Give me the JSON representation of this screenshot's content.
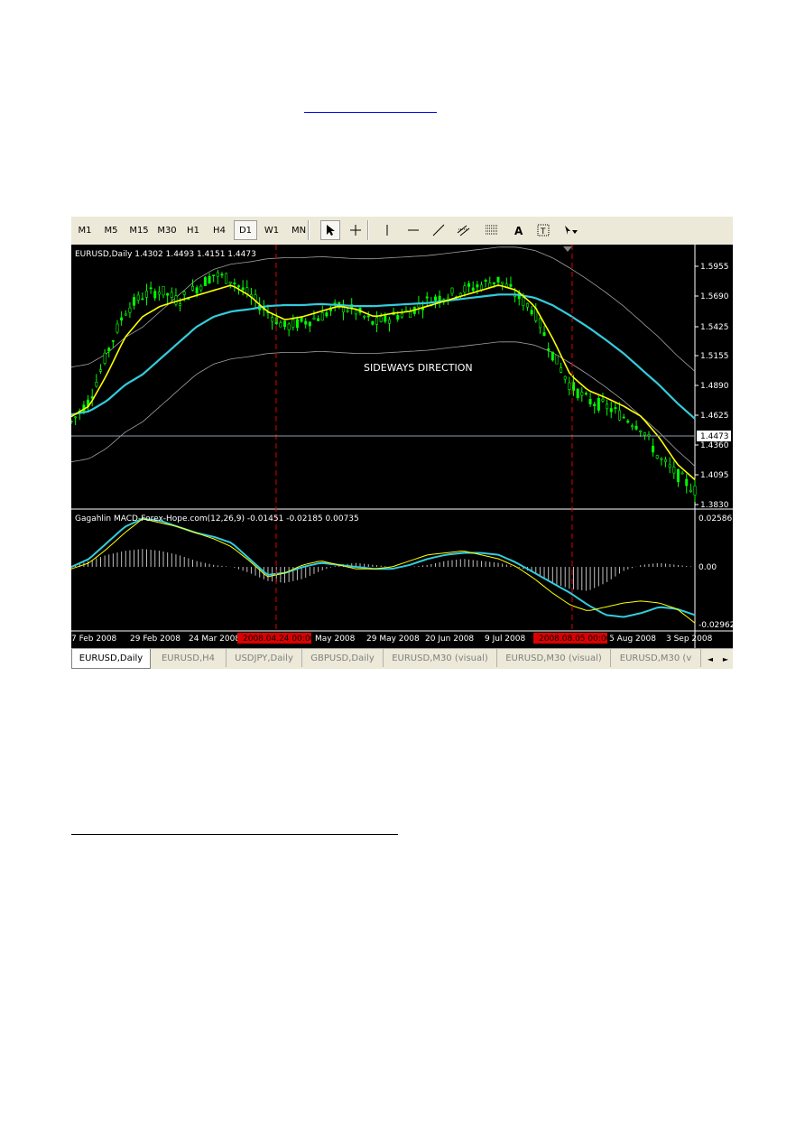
{
  "toolbar": {
    "timeframes": [
      "M1",
      "M5",
      "M15",
      "M30",
      "H1",
      "H4",
      "D1",
      "W1",
      "MN"
    ],
    "active_timeframe": "D1",
    "tools": [
      {
        "name": "cursor-icon",
        "active": true
      },
      {
        "name": "crosshair-icon",
        "active": false
      },
      {
        "name": "vertical-line-icon",
        "active": false
      },
      {
        "name": "horizontal-line-icon",
        "active": false
      },
      {
        "name": "trend-line-icon",
        "active": false
      },
      {
        "name": "equidistant-channel-icon",
        "active": false
      },
      {
        "name": "fibonacci-retracement-icon",
        "active": false
      },
      {
        "name": "text-icon",
        "active": false
      },
      {
        "name": "text-label-icon",
        "active": false
      },
      {
        "name": "arrows-dropdown-icon",
        "active": false
      }
    ]
  },
  "main_chart": {
    "header": "EURUSD,Daily  1.4302 1.4493 1.4151 1.4473",
    "annotation": "SIDEWAYS DIRECTION",
    "price_labels": [
      "1.5955",
      "1.5690",
      "1.5425",
      "1.5155",
      "1.4890",
      "1.4625",
      "1.4360",
      "1.4095",
      "1.3830"
    ],
    "current_price": "1.4473",
    "current_value": 1.4473,
    "y_range": [
      1.373,
      1.608
    ]
  },
  "indicator": {
    "header": "Gagahlin MACD-Forex-Hope.com(12,26,9) -0.01451 -0.02185 0.00735",
    "labels": [
      "0.02586",
      "0.00",
      "-0.02962"
    ],
    "y_range": [
      -0.0315,
      0.0275
    ]
  },
  "time_axis": {
    "labels": [
      "7 Feb 2008",
      "29 Feb 2008",
      "24 Mar 2008",
      "May 2008",
      "29 May 2008",
      "20 Jun 2008",
      "9 Jul 2008",
      "5 Aug 2008",
      "3 Sep 2008"
    ],
    "markers": [
      "2008.04.24 00:00",
      "2008.08.05 00:00"
    ]
  },
  "tabs": [
    "EURUSD,Daily",
    "EURUSD,H4",
    "USDJPY,Daily",
    "GBPUSD,Daily",
    "EURUSD,M30 (visual)",
    "EURUSD,M30 (visual)",
    "EURUSD,M30 (v"
  ],
  "active_tab": "EURUSD,Daily",
  "colors": {
    "background": "#000000",
    "candles": "#00ff00",
    "fast_ma": "#ffff00",
    "slow_ma": "#33ccdd",
    "bands": "#a0a0a0",
    "markers": "#dd0000",
    "histogram": "#c0c0c0"
  },
  "chart_data": {
    "type": "line",
    "series": [],
    "x": [
      "2008-02-07",
      "2008-02-29",
      "2008-03-24",
      "2008-04-24",
      "2008-05-29",
      "2008-06-20",
      "2008-07-09",
      "2008-08-05",
      "2008-09-03"
    ],
    "close_path": [
      1.455,
      1.475,
      1.52,
      1.56,
      1.575,
      1.58,
      1.57,
      1.582,
      1.595,
      1.59,
      1.575,
      1.56,
      1.545,
      1.55,
      1.555,
      1.565,
      1.56,
      1.548,
      1.555,
      1.56,
      1.57,
      1.575,
      1.58,
      1.585,
      1.59,
      1.575,
      1.56,
      1.52,
      1.49,
      1.475,
      1.47,
      1.46,
      1.45,
      1.42,
      1.405,
      1.39
    ],
    "fast_ma": [
      1.46,
      1.47,
      1.5,
      1.535,
      1.555,
      1.565,
      1.57,
      1.575,
      1.58,
      1.585,
      1.575,
      1.56,
      1.552,
      1.555,
      1.56,
      1.565,
      1.562,
      1.555,
      1.558,
      1.56,
      1.565,
      1.57,
      1.575,
      1.58,
      1.585,
      1.58,
      1.565,
      1.535,
      1.5,
      1.485,
      1.478,
      1.47,
      1.46,
      1.44,
      1.415,
      1.4
    ],
    "slow_ma": [
      1.462,
      1.465,
      1.475,
      1.49,
      1.5,
      1.515,
      1.53,
      1.545,
      1.555,
      1.56,
      1.562,
      1.565,
      1.566,
      1.566,
      1.567,
      1.566,
      1.565,
      1.565,
      1.566,
      1.567,
      1.568,
      1.57,
      1.572,
      1.574,
      1.576,
      1.576,
      1.573,
      1.566,
      1.556,
      1.545,
      1.533,
      1.52,
      1.505,
      1.49,
      1.473,
      1.458
    ],
    "macd_histogram": [
      0.0,
      0.003,
      0.006,
      0.008,
      0.009,
      0.008,
      0.006,
      0.003,
      0.001,
      0.0,
      -0.003,
      -0.007,
      -0.008,
      -0.006,
      -0.002,
      0.001,
      0.002,
      0.001,
      0.0,
      0.0,
      0.001,
      0.003,
      0.004,
      0.003,
      0.002,
      0.0,
      -0.003,
      -0.008,
      -0.011,
      -0.012,
      -0.008,
      -0.002,
      0.001,
      0.002,
      0.001,
      0.0
    ],
    "macd_main": [
      0.0,
      0.004,
      0.012,
      0.02,
      0.024,
      0.023,
      0.02,
      0.017,
      0.015,
      0.012,
      0.004,
      -0.004,
      -0.003,
      0.0,
      0.002,
      0.001,
      0.0,
      -0.001,
      -0.001,
      0.001,
      0.004,
      0.006,
      0.007,
      0.007,
      0.006,
      0.002,
      -0.003,
      -0.008,
      -0.013,
      -0.019,
      -0.024,
      -0.025,
      -0.023,
      -0.02,
      -0.021,
      -0.024
    ],
    "macd_signal": [
      -0.001,
      0.002,
      0.009,
      0.017,
      0.024,
      0.022,
      0.02,
      0.017,
      0.014,
      0.01,
      0.003,
      -0.005,
      -0.003,
      0.001,
      0.003,
      0.001,
      -0.001,
      -0.001,
      0.0,
      0.003,
      0.006,
      0.007,
      0.008,
      0.006,
      0.004,
      0.0,
      -0.006,
      -0.013,
      -0.019,
      -0.022,
      -0.02,
      -0.018,
      -0.017,
      -0.018,
      -0.021,
      -0.028
    ]
  }
}
